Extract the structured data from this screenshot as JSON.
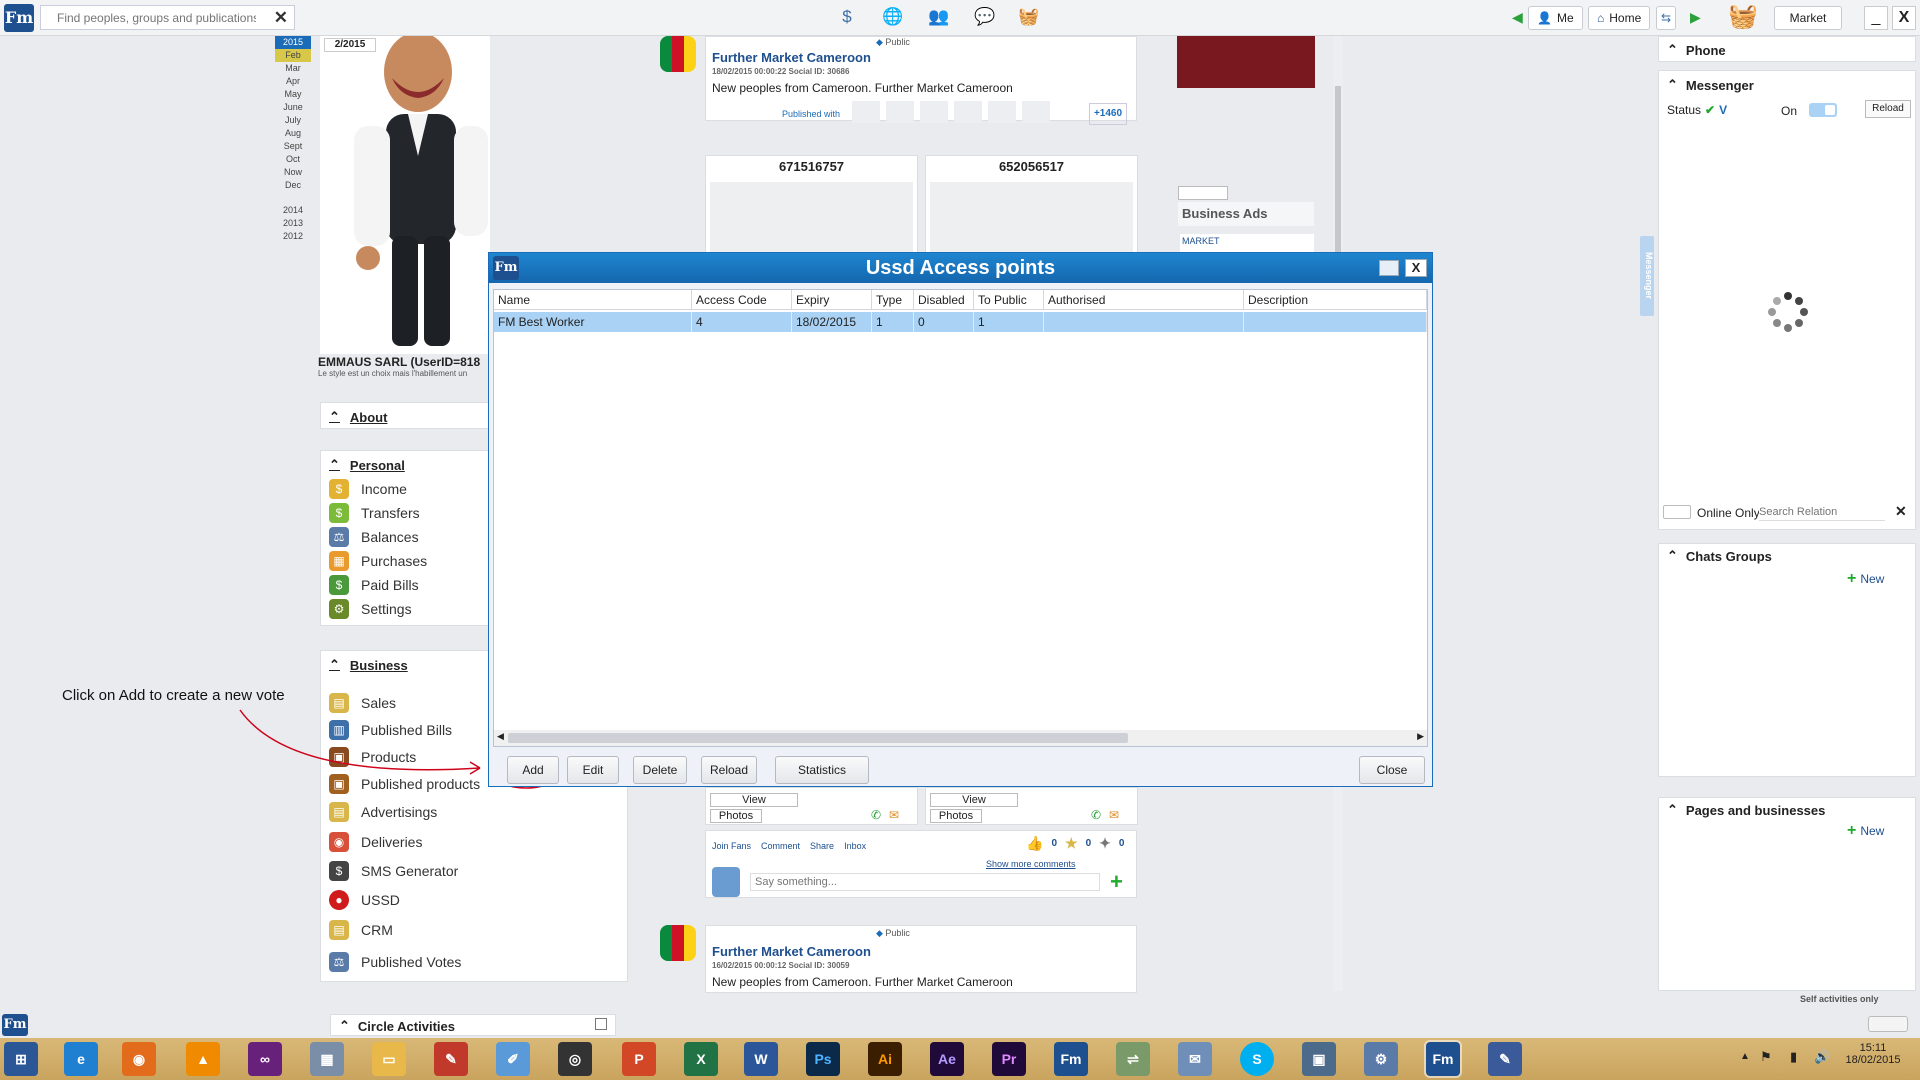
{
  "topbar": {
    "search_placeholder": "Find peoples, groups and publications",
    "me_label": "Me",
    "home_label": "Home",
    "market_label": "Market",
    "minimize": "_",
    "close": "X"
  },
  "timeline": {
    "current_page": "2/2015",
    "years_top": "2015",
    "months": [
      "Feb",
      "Mar",
      "Apr",
      "May",
      "June",
      "July",
      "Aug",
      "Sept",
      "Oct",
      "Now",
      "Dec"
    ],
    "years": [
      "2014",
      "2013",
      "2012"
    ]
  },
  "profile": {
    "name": "EMMAUS SARL (UserID=818",
    "slogan": "Le style est un choix mais l'habillement un"
  },
  "about": {
    "label": "About"
  },
  "personal": {
    "label": "Personal",
    "items": [
      "Income",
      "Transfers",
      "Balances",
      "Purchases",
      "Paid Bills",
      "Settings"
    ]
  },
  "business": {
    "label": "Business",
    "items": [
      "Sales",
      "Published Bills",
      "Products",
      "Published products",
      "Advertisings",
      "Deliveries",
      "SMS Generator",
      "USSD",
      "CRM",
      "Published Votes"
    ]
  },
  "circle": {
    "label": "Circle Activities"
  },
  "annotation": {
    "text": "Click on Add to create a new vote"
  },
  "feed": {
    "post1": {
      "visibility": "Public",
      "title": "Further Market Cameroon",
      "meta": "18/02/2015 00:00:22   Social ID: 30686",
      "body": "New peoples from Cameroon. Further Market Cameroon",
      "published_with": "Published with",
      "count": "+1460"
    },
    "card1": {
      "number": "671516757",
      "view": "View",
      "photos": "Photos"
    },
    "card2": {
      "number": "652056517",
      "view": "View",
      "photos": "Photos"
    },
    "actions": {
      "join": "Join Fans",
      "comment": "Comment",
      "share": "Share",
      "inbox": "Inbox",
      "likes": "0",
      "dislikes": "0",
      "other": "0",
      "more_comments": "Show more comments",
      "say_placeholder": "Say something..."
    },
    "post2": {
      "visibility": "Public",
      "title": "Further Market Cameroon",
      "meta": "16/02/2015 00:00:12   Social ID: 30059",
      "body": "New peoples from Cameroon. Further Market Cameroon"
    },
    "ads": {
      "title": "Business Ads",
      "market": "MARKET"
    }
  },
  "dialog": {
    "title": "Ussd Access points",
    "columns": [
      "Name",
      "Access Code",
      "Expiry",
      "Type",
      "Disabled",
      "To Public",
      "Authorised",
      "Description"
    ],
    "rows": [
      [
        "FM Best Worker",
        "4",
        "18/02/2015",
        "1",
        "0",
        "1",
        "",
        ""
      ]
    ],
    "buttons": {
      "add": "Add",
      "edit": "Edit",
      "delete": "Delete",
      "reload": "Reload",
      "statistics": "Statistics",
      "close": "Close"
    },
    "close_x": "X"
  },
  "sidebar": {
    "phone": "Phone",
    "messenger": "Messenger",
    "status_label": "Status",
    "on_label": "On",
    "reload": "Reload",
    "tab_label": "Messenger",
    "online_only": "Online Only",
    "search_relation_placeholder": "Search Relation",
    "chats_groups": "Chats Groups",
    "pages_businesses": "Pages and businesses",
    "new_label": "New",
    "self_activities": "Self activities only"
  },
  "taskbar": {
    "time": "15:11",
    "date": "18/02/2015",
    "apps": [
      "start",
      "ie",
      "firefox",
      "vlc",
      "vs",
      "calc",
      "explorer",
      "adobe",
      "notepad",
      "camera",
      "powerpoint",
      "excel",
      "word",
      "photoshop",
      "illustrator",
      "aftereffects",
      "premiere",
      "fm",
      "network",
      "mail",
      "skype",
      "window",
      "settings",
      "fm-active",
      "paint"
    ]
  },
  "colors": {
    "accent": "#1a6cb8",
    "selected_row": "#a9d2f5",
    "annotation": "#d0021b"
  }
}
